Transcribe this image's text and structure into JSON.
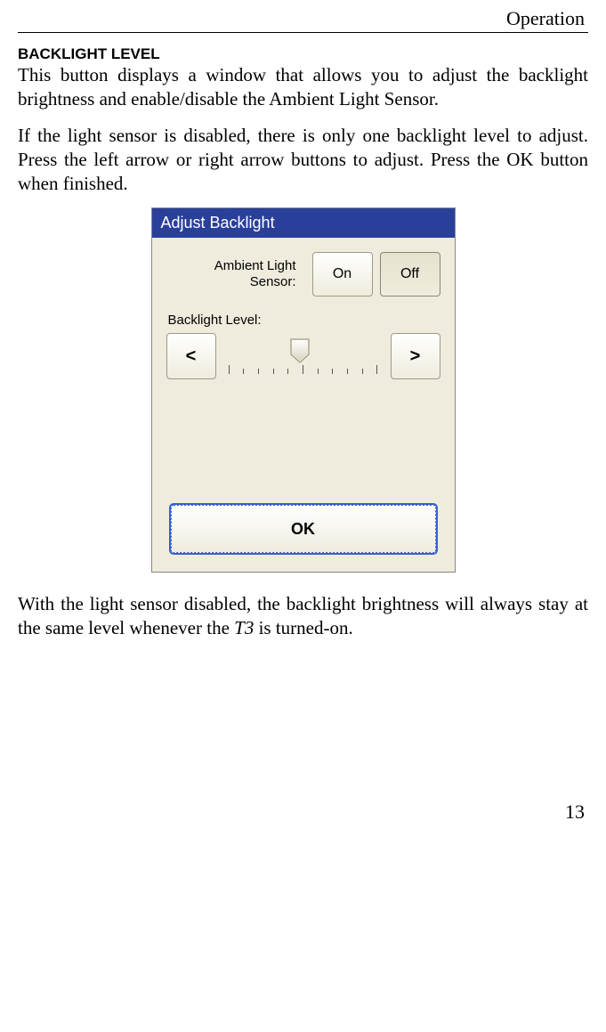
{
  "header": {
    "title": "Operation"
  },
  "section": {
    "heading": "BACKLIGHT LEVEL",
    "para1_a": "This button displays a window that allows you to adjust the backlight brightness and enable/disable the Ambient Light Sensor.",
    "para2_a": "If the light sensor is disabled, there is only one backlight level to adjust. Press the left arrow or right arrow buttons to adjust. Press the ",
    "para2_ok": "OK",
    "para2_b": " button when finished.",
    "para3_a": "With the light sensor disabled, the backlight brightness will always stay at the same level whenever the ",
    "para3_t3": "T3",
    "para3_b": " is turned-on."
  },
  "dialog": {
    "title": "Adjust Backlight",
    "als_label_line1": "Ambient Light",
    "als_label_line2": "Sensor:",
    "on_label": "On",
    "off_label": "Off",
    "bl_label": "Backlight Level:",
    "left_arrow": "<",
    "right_arrow": ">",
    "ok_label": "OK"
  },
  "page_number": "13"
}
